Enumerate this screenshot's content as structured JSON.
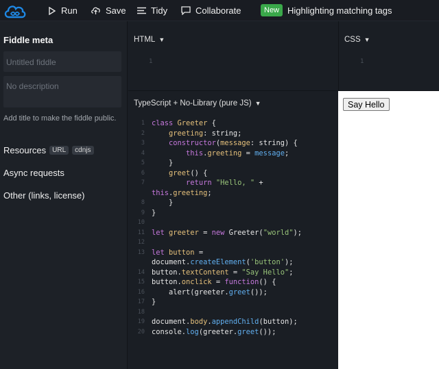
{
  "toolbar": {
    "run_label": "Run",
    "save_label": "Save",
    "tidy_label": "Tidy",
    "collaborate_label": "Collaborate",
    "new_badge": "New",
    "new_feature": "Highlighting matching tags"
  },
  "sidebar": {
    "title": "Fiddle meta",
    "title_placeholder": "Untitled fiddle",
    "description_placeholder": "No description",
    "hint": "Add title to make the fiddle public.",
    "resources_label": "Resources",
    "resources_chips": [
      "URL",
      "cdnjs"
    ],
    "async_label": "Async requests",
    "other_label": "Other (links, license)"
  },
  "panels": {
    "html_label": "HTML",
    "css_label": "CSS",
    "js_label": "TypeScript + No-Library (pure JS)",
    "html_line": "1",
    "css_line": "1"
  },
  "code_lines": [
    {
      "n": "1",
      "parts": [
        [
          "kw",
          "class "
        ],
        [
          "prop",
          "Greeter"
        ],
        [
          "ty",
          " {"
        ]
      ]
    },
    {
      "n": "2",
      "parts": [
        [
          "ty",
          "    "
        ],
        [
          "prop",
          "greeting"
        ],
        [
          "ty",
          ": string;"
        ]
      ]
    },
    {
      "n": "3",
      "parts": [
        [
          "ty",
          "    "
        ],
        [
          "kw",
          "constructor"
        ],
        [
          "ty",
          "("
        ],
        [
          "prop",
          "message"
        ],
        [
          "ty",
          ": string) {"
        ]
      ]
    },
    {
      "n": "4",
      "parts": [
        [
          "ty",
          "        "
        ],
        [
          "kw",
          "this"
        ],
        [
          "ty",
          "."
        ],
        [
          "prop",
          "greeting"
        ],
        [
          "ty",
          " = "
        ],
        [
          "fn",
          "message"
        ],
        [
          "ty",
          ";"
        ]
      ]
    },
    {
      "n": "5",
      "parts": [
        [
          "ty",
          "    }"
        ]
      ]
    },
    {
      "n": "6",
      "parts": [
        [
          "ty",
          "    "
        ],
        [
          "prop",
          "greet"
        ],
        [
          "ty",
          "() {"
        ]
      ]
    },
    {
      "n": "7",
      "parts": [
        [
          "ty",
          "        "
        ],
        [
          "kw",
          "return "
        ],
        [
          "str",
          "\"Hello, \""
        ],
        [
          "ty",
          " +"
        ]
      ]
    },
    {
      "n": "",
      "parts": [
        [
          "kw",
          "this"
        ],
        [
          "ty",
          "."
        ],
        [
          "prop",
          "greeting"
        ],
        [
          "ty",
          ";"
        ]
      ]
    },
    {
      "n": "8",
      "parts": [
        [
          "ty",
          "    }"
        ]
      ]
    },
    {
      "n": "9",
      "parts": [
        [
          "ty",
          "}"
        ]
      ]
    },
    {
      "n": "10",
      "parts": []
    },
    {
      "n": "11",
      "parts": [
        [
          "kw",
          "let "
        ],
        [
          "prop",
          "greeter"
        ],
        [
          "ty",
          " = "
        ],
        [
          "kw",
          "new "
        ],
        [
          "ty",
          "Greeter("
        ],
        [
          "str",
          "\"world\""
        ],
        [
          "ty",
          ");"
        ]
      ]
    },
    {
      "n": "12",
      "parts": []
    },
    {
      "n": "13",
      "parts": [
        [
          "kw",
          "let "
        ],
        [
          "prop",
          "button"
        ],
        [
          "ty",
          " ="
        ]
      ]
    },
    {
      "n": "",
      "parts": [
        [
          "ty",
          "document."
        ],
        [
          "fn",
          "createElement"
        ],
        [
          "ty",
          "("
        ],
        [
          "str",
          "'button'"
        ],
        [
          "ty",
          ");"
        ]
      ]
    },
    {
      "n": "14",
      "parts": [
        [
          "ty",
          "button."
        ],
        [
          "prop",
          "textContent"
        ],
        [
          "ty",
          " = "
        ],
        [
          "str",
          "\"Say Hello\""
        ],
        [
          "ty",
          ";"
        ]
      ]
    },
    {
      "n": "15",
      "parts": [
        [
          "ty",
          "button."
        ],
        [
          "prop",
          "onclick"
        ],
        [
          "ty",
          " = "
        ],
        [
          "kw",
          "function"
        ],
        [
          "ty",
          "() {"
        ]
      ]
    },
    {
      "n": "16",
      "parts": [
        [
          "ty",
          "    alert(greeter."
        ],
        [
          "fn",
          "greet"
        ],
        [
          "ty",
          "());"
        ]
      ]
    },
    {
      "n": "17",
      "parts": [
        [
          "ty",
          "}"
        ]
      ]
    },
    {
      "n": "18",
      "parts": []
    },
    {
      "n": "19",
      "parts": [
        [
          "ty",
          "document."
        ],
        [
          "prop",
          "body"
        ],
        [
          "ty",
          "."
        ],
        [
          "fn",
          "appendChild"
        ],
        [
          "ty",
          "(button);"
        ]
      ]
    },
    {
      "n": "20",
      "parts": [
        [
          "ty",
          "console."
        ],
        [
          "fn",
          "log"
        ],
        [
          "ty",
          "(greeter."
        ],
        [
          "fn",
          "greet"
        ],
        [
          "ty",
          "());"
        ]
      ]
    }
  ],
  "result": {
    "button_label": "Say Hello"
  },
  "colors": {
    "accent": "#1e88e5",
    "badge": "#3aa84a"
  },
  "icons": [
    "cloud-logo-icon",
    "play-icon",
    "cloud-upload-icon",
    "tidy-lines-icon",
    "chat-bubble-icon",
    "caret-down-icon"
  ]
}
